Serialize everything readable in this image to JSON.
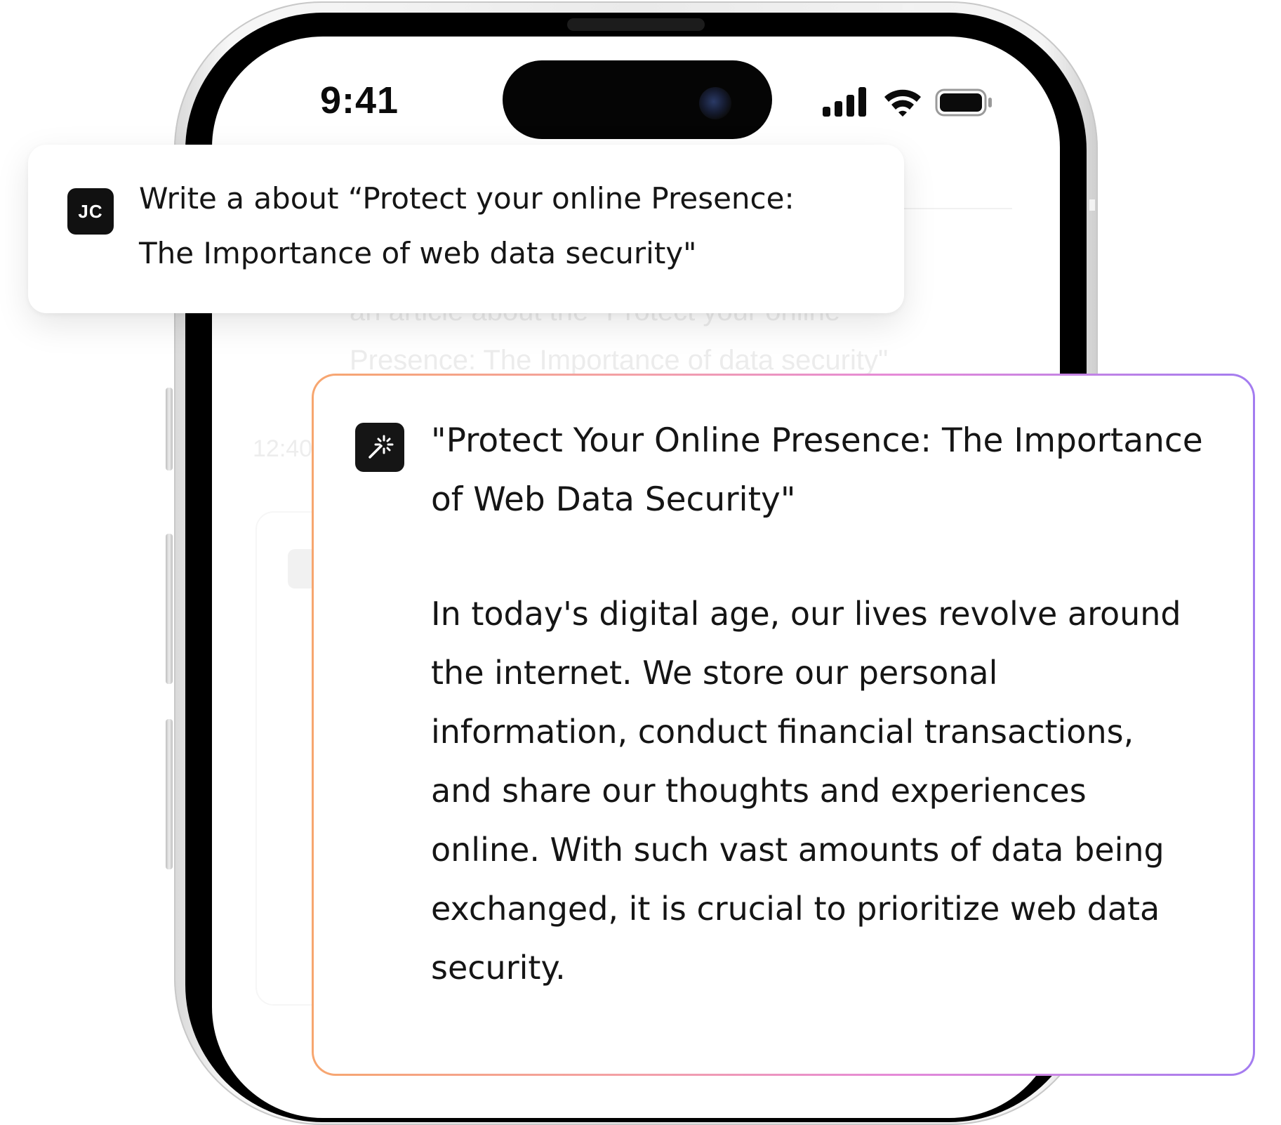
{
  "status_bar": {
    "time": "9:41",
    "signal_icon": "cellular-signal-icon",
    "wifi_icon": "wifi-icon",
    "battery_icon": "battery-icon"
  },
  "background_chat": {
    "prompt_text": "rite\nan article about the \"Protect your online\nPresence: The Importance of data security\"",
    "timestamp": "12:40"
  },
  "user_prompt": {
    "avatar_initials": "JC",
    "line1": "Write a about “Protect your online Presence:",
    "line2": "The Importance of web data security\""
  },
  "ai_response": {
    "icon": "magic-wand-icon",
    "title": "\"Protect Your Online Presence: The Importance of Web Data Security\"",
    "body": "In today's digital age, our lives revolve around the internet. We store our personal information, conduct financial transactions, and share our thoughts and experiences online. With such vast amounts of data being exchanged, it is crucial to prioritize web data security.",
    "border_gradient": [
      "#f7a66f",
      "#f3a0a8",
      "#e58ad8",
      "#a37cf0"
    ]
  },
  "colors": {
    "phone_bezel": "#000000",
    "island": "#050505",
    "avatar_bg": "#111111",
    "text": "#151515"
  }
}
